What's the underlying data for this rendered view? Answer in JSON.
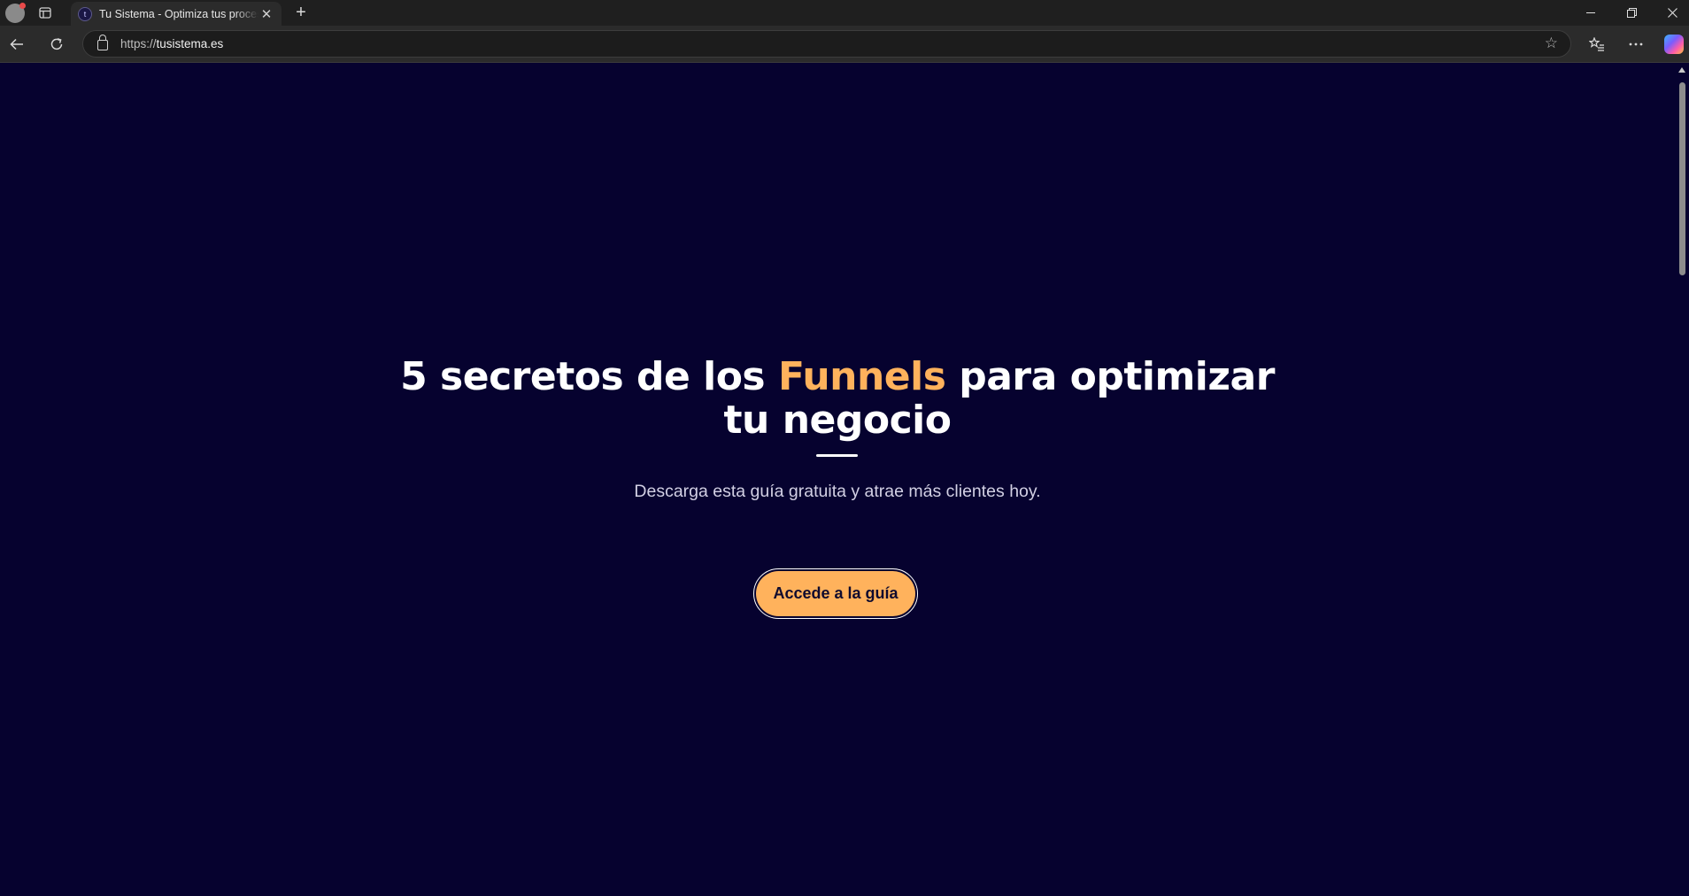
{
  "browser": {
    "tab_title": "Tu Sistema - Optimiza tus procesos",
    "tab_favicon_letter": "t",
    "url_scheme": "https://",
    "url_host": "tusistema.es"
  },
  "hero": {
    "title_part1": "5 secretos de los ",
    "title_highlight": "Funnels",
    "title_part2": " para optimizar tu negocio",
    "subtitle": "Descarga esta guía gratuita y atrae más clientes hoy.",
    "cta_label": "Accede a la guía"
  },
  "colors": {
    "page_background": "#06022f",
    "accent": "#ffb25c",
    "text": "#ffffff"
  }
}
